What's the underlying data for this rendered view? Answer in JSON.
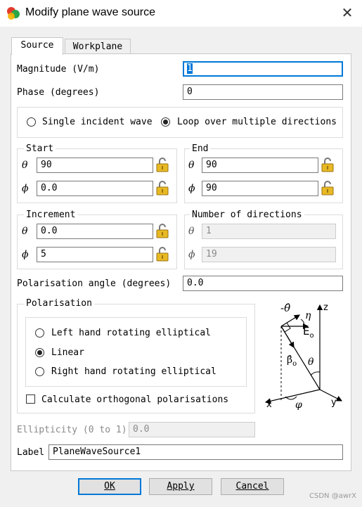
{
  "window": {
    "title": "Modify plane wave source"
  },
  "tabs": [
    {
      "label": "Source",
      "active": true
    },
    {
      "label": "Workplane",
      "active": false
    }
  ],
  "fields": {
    "magnitude": {
      "label": "Magnitude (V/m)",
      "value": "1"
    },
    "phase": {
      "label": "Phase (degrees)",
      "value": "0"
    }
  },
  "incidence": {
    "single_label": "Single incident wave",
    "loop_label": "Loop over multiple directions",
    "selected": "loop"
  },
  "start": {
    "legend": "Start",
    "theta": "90",
    "phi": "0.0"
  },
  "end": {
    "legend": "End",
    "theta": "90",
    "phi": "90"
  },
  "increment": {
    "legend": "Increment",
    "theta": "0.0",
    "phi": "5"
  },
  "num_directions": {
    "legend": "Number of directions",
    "theta": "1",
    "phi": "19"
  },
  "symbols": {
    "theta": "θ",
    "phi": "ϕ"
  },
  "polarisation_angle": {
    "label": "Polarisation angle (degrees)",
    "value": "0.0"
  },
  "polarisation": {
    "legend": "Polarisation",
    "options": [
      "Left hand rotating elliptical",
      "Linear",
      "Right hand rotating elliptical"
    ],
    "selected_index": 1,
    "orthogonal_label": "Calculate orthogonal polarisations",
    "orthogonal_checked": false
  },
  "diagram": {
    "minus_theta_hat": "-θ̂",
    "eta": "η",
    "e0": "E",
    "e0_sub": "o",
    "beta0": "β̂",
    "beta0_sub": "o",
    "theta": "θ",
    "phi": "φ",
    "z": "z",
    "x": "x",
    "y": "y"
  },
  "ellipticity": {
    "label": "Ellipticity (0 to 1)",
    "value": "0.0"
  },
  "label_field": {
    "label": "Label",
    "value": "PlaneWaveSource1"
  },
  "buttons": {
    "ok": "OK",
    "apply": "Apply",
    "cancel": "Cancel"
  },
  "watermark": "CSDN @awrX",
  "colors": {
    "accent": "#0078d7",
    "lock": "#e8b923"
  }
}
